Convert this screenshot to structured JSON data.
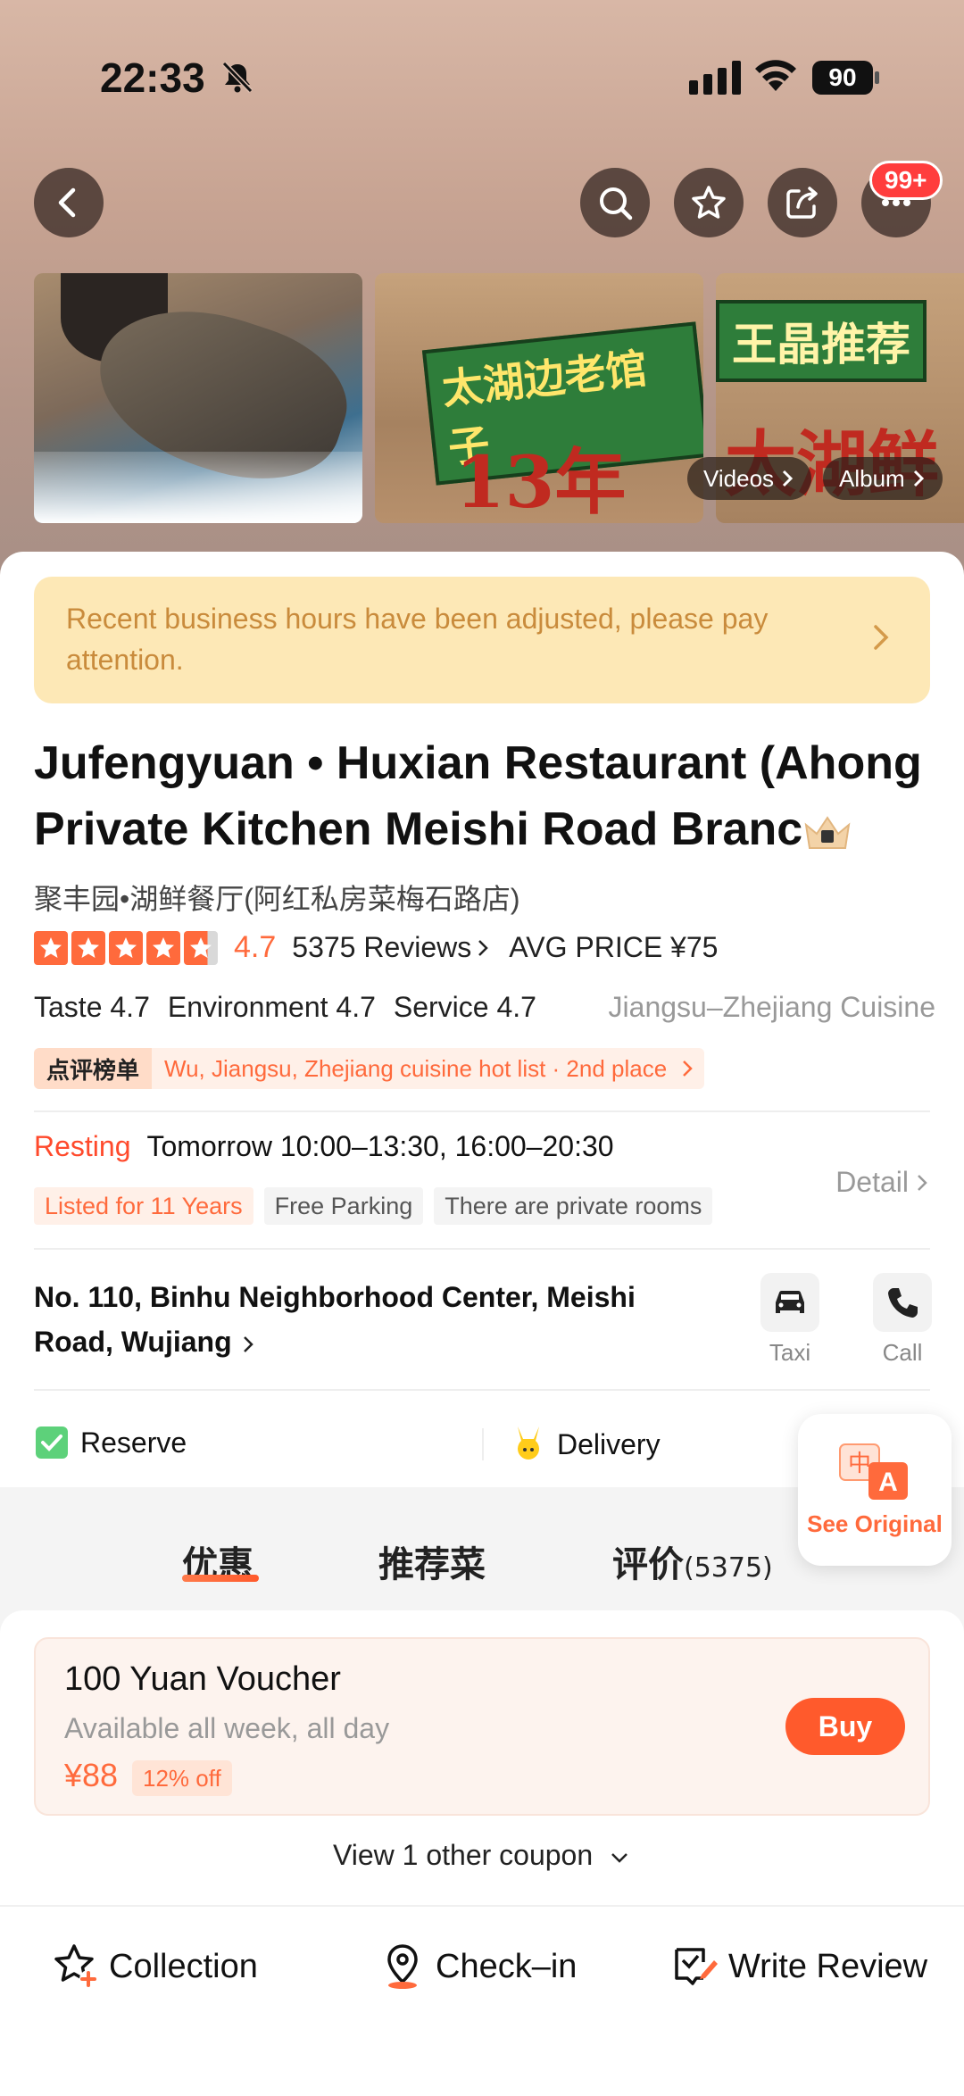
{
  "status_bar": {
    "time": "22:33",
    "battery": "90"
  },
  "nav": {
    "badge": "99+"
  },
  "photos": {
    "banner1": "太湖边老馆子",
    "banner2": "王晶推荐",
    "red1": "13年",
    "red2": "太湖鲜味",
    "videos_label": "Videos",
    "album_label": "Album"
  },
  "notice": {
    "text": "Recent business hours have been adjusted, please pay attention."
  },
  "restaurant": {
    "title": "Jufengyuan • Huxian Restaurant (Ahong Private Kitchen Meishi Road Branc",
    "subtitle": "聚丰园•湖鲜餐厅(阿红私房菜梅石路店)",
    "rating": 4.7,
    "rating_text": "4.7",
    "reviews": "5375 Reviews",
    "avg_price": "AVG PRICE ¥75",
    "taste": "Taste 4.7",
    "environment": "Environment 4.7",
    "service": "Service 4.7",
    "cuisine": "Jiangsu–Zhejiang Cuisine",
    "hot_tag": "点评榜单",
    "hot_text": "Wu, Jiangsu, Zhejiang cuisine hot list · 2nd place"
  },
  "hours": {
    "status": "Resting",
    "text": "Tomorrow 10:00–13:30, 16:00–20:30",
    "detail": "Detail"
  },
  "tags": [
    "Listed for 11 Years",
    "Free Parking",
    "There are private rooms"
  ],
  "address": {
    "text": "No. 110, Binhu Neighborhood Center, Meishi Road, Wujiang",
    "taxi": "Taxi",
    "call": "Call"
  },
  "features": {
    "reserve": "Reserve",
    "delivery": "Delivery"
  },
  "translate": {
    "label": "See Original",
    "zh": "中",
    "en": "A"
  },
  "tabs": [
    {
      "label": "优惠"
    },
    {
      "label": "推荐菜"
    },
    {
      "label": "评价",
      "count": "(5375)"
    }
  ],
  "voucher": {
    "title": "100 Yuan Voucher",
    "subtitle": "Available all week, all day",
    "price": "¥88",
    "discount": "12% off",
    "buy": "Buy",
    "more": "View 1 other coupon"
  },
  "bottom_bar": {
    "collection": "Collection",
    "checkin": "Check–in",
    "review": "Write Review"
  },
  "colors": {
    "accent": "#ff6a3c",
    "notice_bg": "#fde8b6",
    "notice_text": "#c98b3c",
    "resting": "#ff4a2c"
  }
}
